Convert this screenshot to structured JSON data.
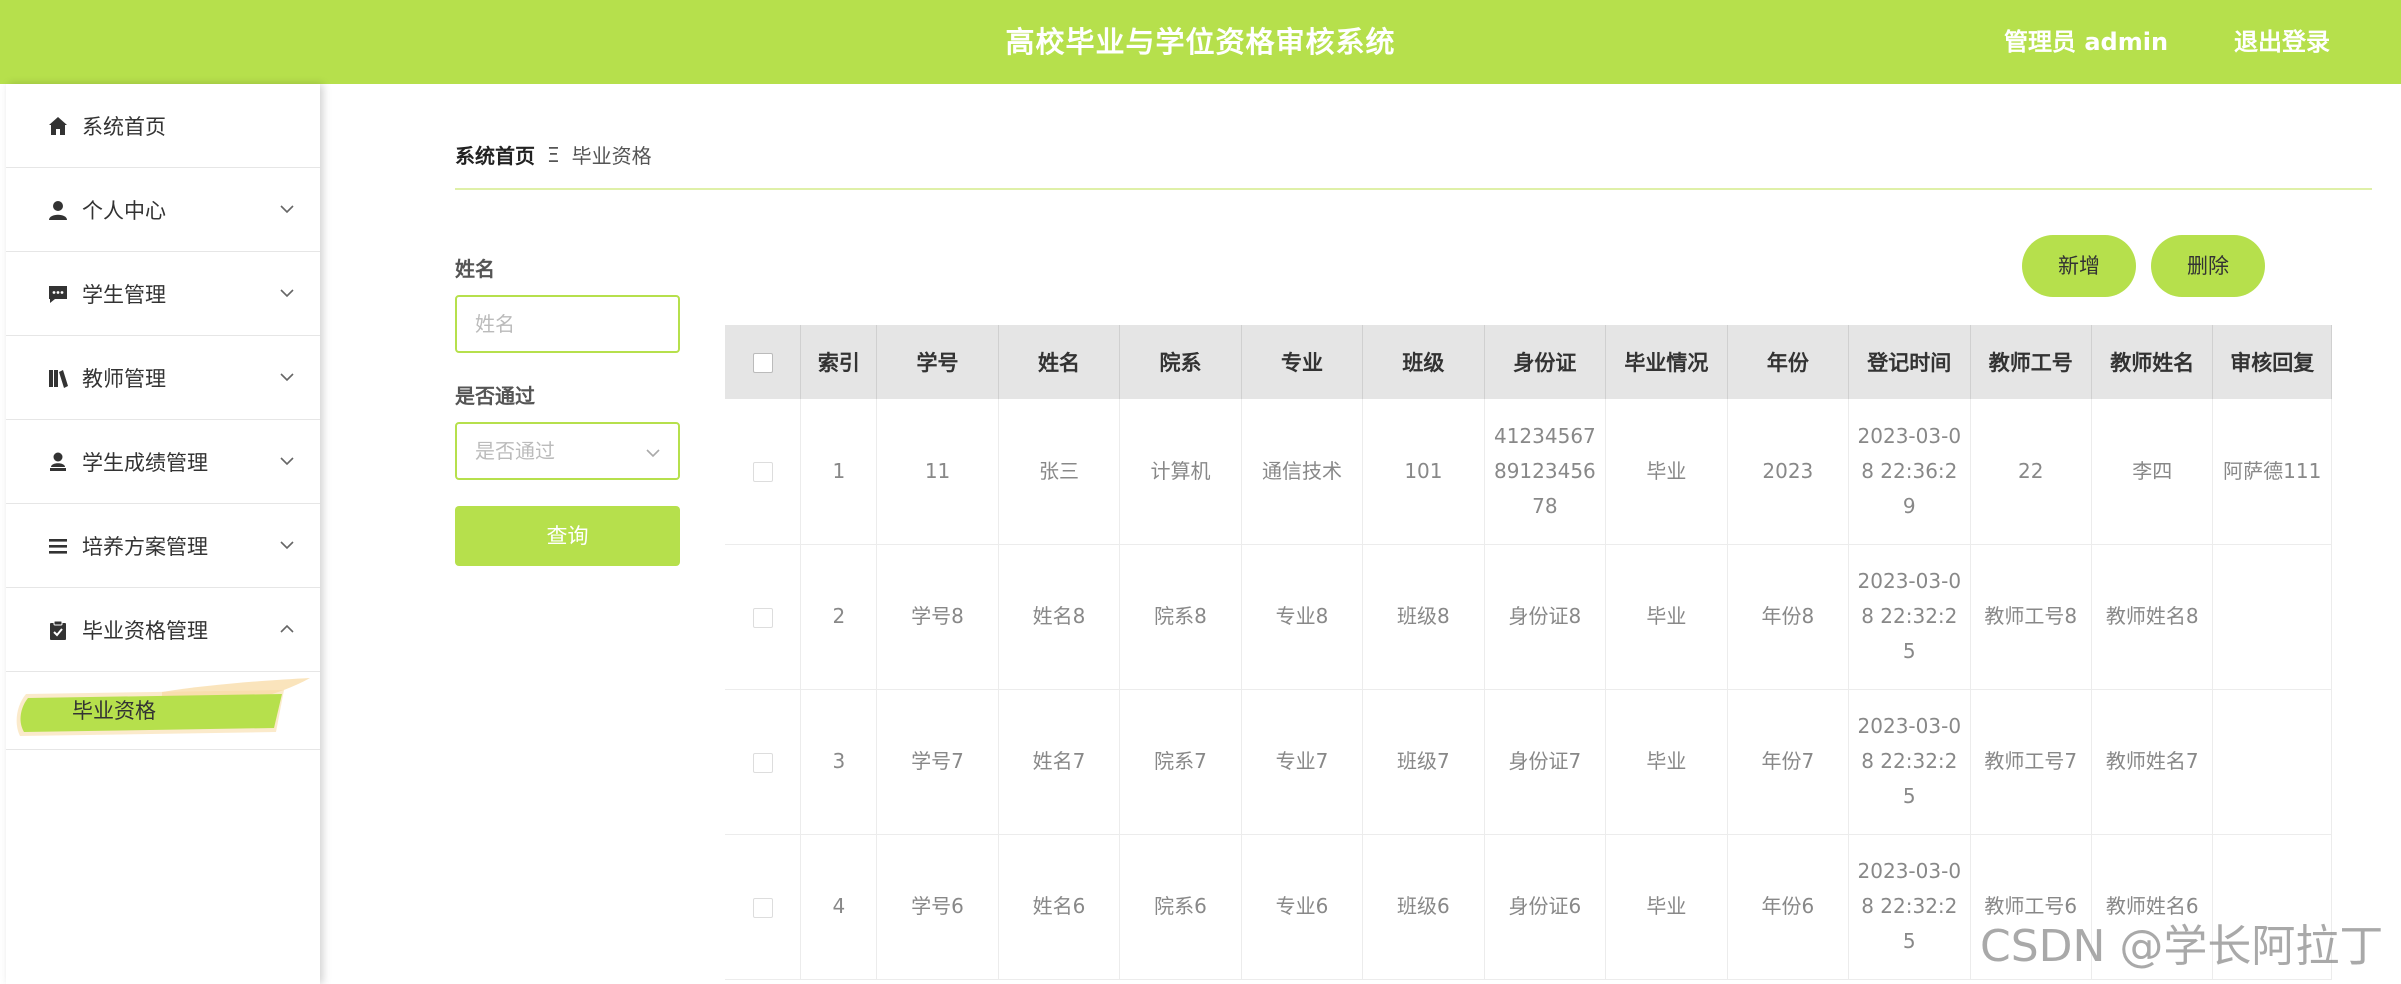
{
  "header": {
    "title": "高校毕业与学位资格审核系统",
    "admin_label": "管理员 admin",
    "logout_label": "退出登录"
  },
  "sidebar": {
    "items": [
      {
        "label": "系统首页",
        "icon": "home-icon"
      },
      {
        "label": "个人中心",
        "icon": "user-icon"
      },
      {
        "label": "学生管理",
        "icon": "chat-icon"
      },
      {
        "label": "教师管理",
        "icon": "books-icon"
      },
      {
        "label": "学生成绩管理",
        "icon": "person-stamp-icon"
      },
      {
        "label": "培养方案管理",
        "icon": "list-icon"
      },
      {
        "label": "毕业资格管理",
        "icon": "clipboard-check-icon"
      }
    ],
    "active_sub": "毕业资格"
  },
  "breadcrumb": {
    "home": "系统首页",
    "separator": "Ξ",
    "current": "毕业资格"
  },
  "search": {
    "name_label": "姓名",
    "name_placeholder": "姓名",
    "pass_label": "是否通过",
    "pass_placeholder": "是否通过",
    "query_label": "查询"
  },
  "actions": {
    "add_label": "新增",
    "delete_label": "删除"
  },
  "table": {
    "columns": [
      "索引",
      "学号",
      "姓名",
      "院系",
      "专业",
      "班级",
      "身份证",
      "毕业情况",
      "年份",
      "登记时间",
      "教师工号",
      "教师姓名",
      "审核回复"
    ],
    "rows": [
      {
        "index": "1",
        "xuehao": "11",
        "name": "张三",
        "dept": "计算机",
        "major": "通信技术",
        "cls": "101",
        "idcard": "412345678912345678",
        "status": "毕业",
        "year": "2023",
        "time": "2023-03-08 22:36:29",
        "tid": "22",
        "tname": "李四",
        "reply": "阿萨德111"
      },
      {
        "index": "2",
        "xuehao": "学号8",
        "name": "姓名8",
        "dept": "院系8",
        "major": "专业8",
        "cls": "班级8",
        "idcard": "身份证8",
        "status": "毕业",
        "year": "年份8",
        "time": "2023-03-08 22:32:25",
        "tid": "教师工号8",
        "tname": "教师姓名8",
        "reply": ""
      },
      {
        "index": "3",
        "xuehao": "学号7",
        "name": "姓名7",
        "dept": "院系7",
        "major": "专业7",
        "cls": "班级7",
        "idcard": "身份证7",
        "status": "毕业",
        "year": "年份7",
        "time": "2023-03-08 22:32:25",
        "tid": "教师工号7",
        "tname": "教师姓名7",
        "reply": ""
      },
      {
        "index": "4",
        "xuehao": "学号6",
        "name": "姓名6",
        "dept": "院系6",
        "major": "专业6",
        "cls": "班级6",
        "idcard": "身份证6",
        "status": "毕业",
        "year": "年份6",
        "time": "2023-03-08 22:32:25",
        "tid": "教师工号6",
        "tname": "教师姓名6",
        "reply": ""
      }
    ]
  },
  "watermark": "CSDN @学长阿拉丁",
  "colors": {
    "accent": "#b6e04c",
    "header_bg": "#e5e5e5"
  }
}
